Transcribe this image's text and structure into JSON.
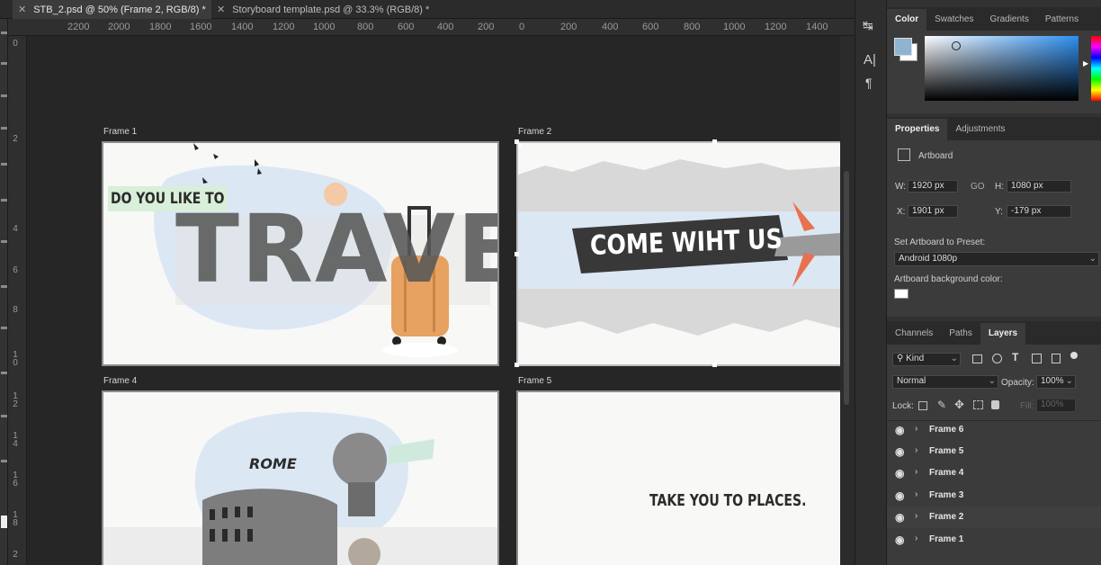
{
  "tabs": [
    {
      "label": "STB_2.psd @ 50% (Frame 2, RGB/8) *"
    },
    {
      "label": "Storyboard template.psd @ 33.3% (RGB/8) *"
    }
  ],
  "ruler": {
    "h_labels": [
      "2200",
      "2000",
      "1800",
      "1600",
      "1400",
      "1200",
      "1000",
      "800",
      "600",
      "400",
      "200",
      "0",
      "200",
      "400",
      "600",
      "800",
      "1000",
      "1200",
      "1400"
    ],
    "v_labels": [
      "0",
      "2",
      "4",
      "6",
      "8",
      "1 0",
      "1 2",
      "1 4",
      "1 6",
      "1 8",
      "2"
    ]
  },
  "canvas": {
    "frames": [
      {
        "label": "Frame 1",
        "small_text": "DO YOU LIKE TO",
        "big_text": "TRAVEL"
      },
      {
        "label": "Frame 2",
        "banner_text": "COME WIHT US"
      },
      {
        "label": "Frame 4",
        "city_text": "ROME"
      },
      {
        "label": "Frame 5",
        "tagline": "TAKE YOU TO PLACES."
      }
    ]
  },
  "color_panel": {
    "tabs": [
      "Color",
      "Swatches",
      "Gradients",
      "Patterns"
    ],
    "active": "Color",
    "swatch_fg": "#8fb4d2",
    "swatch_bg": "#ffffff"
  },
  "properties": {
    "tabs": [
      "Properties",
      "Adjustments"
    ],
    "type": "Artboard",
    "w_label": "W:",
    "w": "1920 px",
    "link_label": "GO",
    "h_label": "H:",
    "h": "1080 px",
    "x_label": "X:",
    "x": "1901 px",
    "y_label": "Y:",
    "y": "-179 px",
    "preset_label": "Set Artboard to Preset:",
    "preset": "Android 1080p",
    "bg_label": "Artboard background color:",
    "bg_color": "#ffffff"
  },
  "layers_panel": {
    "tabs": [
      "Channels",
      "Paths",
      "Layers"
    ],
    "kind": "Kind",
    "blend": "Normal",
    "opacity_label": "Opacity:",
    "opacity": "100%",
    "lock_label": "Lock:",
    "fill_label": "Fill:",
    "fill": "100%",
    "layers": [
      {
        "name": "Frame 6"
      },
      {
        "name": "Frame 5"
      },
      {
        "name": "Frame 4"
      },
      {
        "name": "Frame 3"
      },
      {
        "name": "Frame 2"
      },
      {
        "name": "Frame 1"
      }
    ]
  },
  "colors": {
    "accent": "#2f6fd0",
    "canvas_bg": "#262626",
    "travel_blob": "#dce7f4",
    "suitcase": "#e7a160"
  }
}
